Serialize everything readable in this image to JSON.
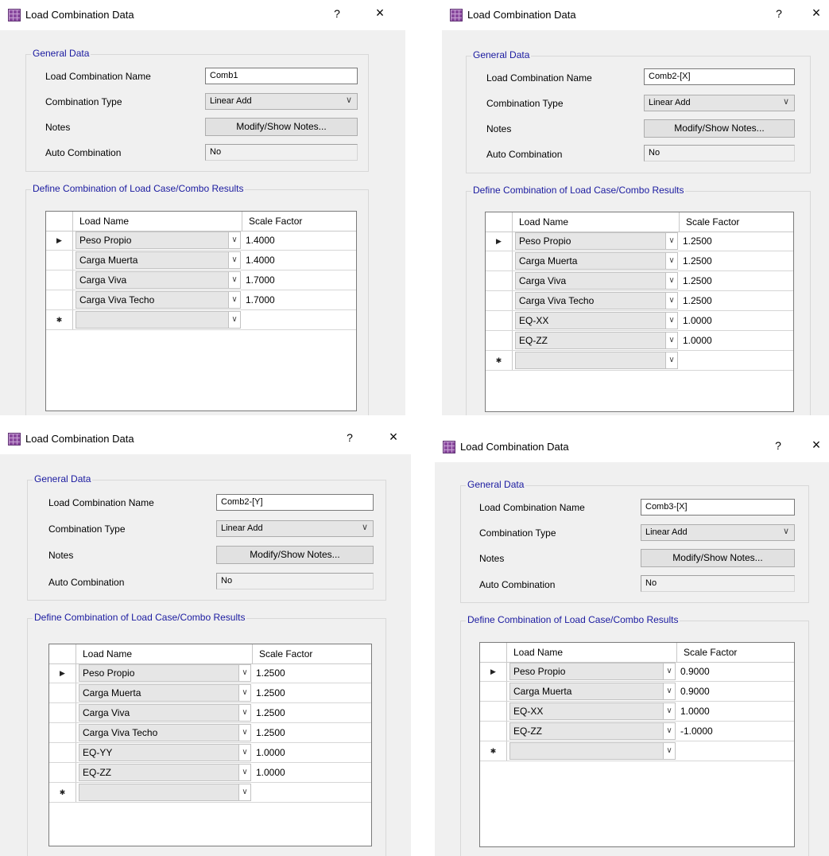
{
  "colors": {
    "group_title": "#1a1aa0",
    "dialog_bg": "#f0f0f0",
    "titlebar_bg": "#ffffff"
  },
  "common": {
    "title": "Load Combination Data",
    "help": "?",
    "close": "×",
    "general_data": "General Data",
    "name_label": "Load Combination Name",
    "type_label": "Combination Type",
    "notes_label": "Notes",
    "auto_label": "Auto Combination",
    "notes_button": "Modify/Show Notes...",
    "define_group": "Define Combination of Load Case/Combo Results",
    "col_load": "Load Name",
    "col_scale": "Scale Factor",
    "current_row_marker": "▶",
    "new_row_marker": "✱",
    "dropdown_icon": "chevron-down-icon"
  },
  "dialogs": [
    {
      "combo_name": "Comb1",
      "combo_type": "Linear Add",
      "auto_combination": "No",
      "rows": [
        {
          "load": "Peso Propio",
          "scale": "1.4000"
        },
        {
          "load": "Carga Muerta",
          "scale": "1.4000"
        },
        {
          "load": "Carga Viva",
          "scale": "1.7000"
        },
        {
          "load": "Carga Viva Techo",
          "scale": "1.7000"
        }
      ]
    },
    {
      "combo_name": "Comb2-[X]",
      "combo_type": "Linear Add",
      "auto_combination": "No",
      "rows": [
        {
          "load": "Peso Propio",
          "scale": "1.2500"
        },
        {
          "load": "Carga Muerta",
          "scale": "1.2500"
        },
        {
          "load": "Carga Viva",
          "scale": "1.2500"
        },
        {
          "load": "Carga Viva Techo",
          "scale": "1.2500"
        },
        {
          "load": "EQ-XX",
          "scale": "1.0000"
        },
        {
          "load": "EQ-ZZ",
          "scale": "1.0000"
        }
      ]
    },
    {
      "combo_name": "Comb2-[Y]",
      "combo_type": "Linear Add",
      "auto_combination": "No",
      "rows": [
        {
          "load": "Peso Propio",
          "scale": "1.2500"
        },
        {
          "load": "Carga Muerta",
          "scale": "1.2500"
        },
        {
          "load": "Carga Viva",
          "scale": "1.2500"
        },
        {
          "load": "Carga Viva Techo",
          "scale": "1.2500"
        },
        {
          "load": "EQ-YY",
          "scale": "1.0000"
        },
        {
          "load": "EQ-ZZ",
          "scale": "1.0000"
        }
      ]
    },
    {
      "combo_name": "Comb3-[X]",
      "combo_type": "Linear Add",
      "auto_combination": "No",
      "rows": [
        {
          "load": "Peso Propio",
          "scale": "0.9000"
        },
        {
          "load": "Carga Muerta",
          "scale": "0.9000"
        },
        {
          "load": "EQ-XX",
          "scale": "1.0000"
        },
        {
          "load": "EQ-ZZ",
          "scale": "-1.0000"
        }
      ]
    }
  ]
}
